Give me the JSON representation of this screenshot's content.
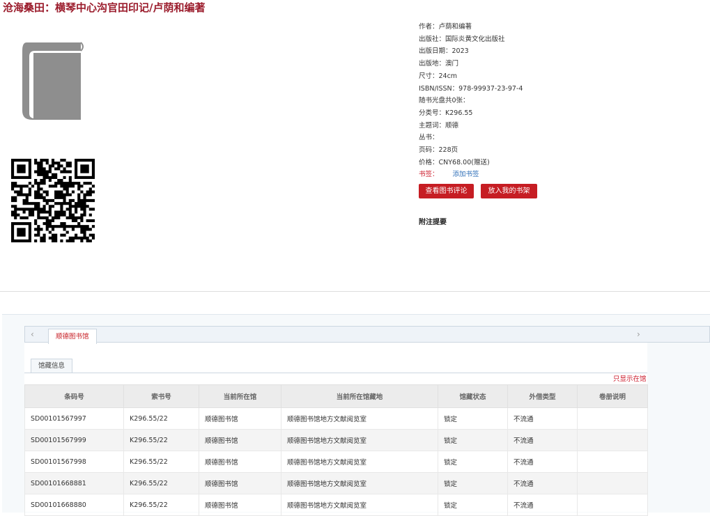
{
  "title": "沧海桑田：横琴中心沟官田印记/卢荫和编著",
  "meta": {
    "author": "作者：卢荫和编著",
    "publisher": "出版社：国际炎黄文化出版社",
    "pub_date": "出版日期：2023",
    "pub_place": "出版地：澳门",
    "size": "尺寸：24cm",
    "isbn": "ISBN/ISSN：978-99937-23-97-4",
    "cd": "随书光盘共0张：",
    "class_no": "分类号：K296.55",
    "subject": "主题词：顺德",
    "series": "丛书：",
    "pages": "页码：228页",
    "price": "价格：CNY68.00(赠送)",
    "bookmark_label": "书签：",
    "bookmark_link": "添加书签"
  },
  "buttons": {
    "reviews": "查看图书评论",
    "shelf": "放入我的书架"
  },
  "note_title": "附注提要",
  "tabs": {
    "prev": "‹",
    "next": "›",
    "library": "顺德图书馆",
    "holdings": "馆藏信息",
    "show_only": "只显示在馆"
  },
  "table": {
    "headers": [
      "条码号",
      "索书号",
      "当前所在馆",
      "当前所在馆藏地",
      "馆藏状态",
      "外借类型",
      "卷册说明"
    ],
    "rows": [
      [
        "SD00101567997",
        "K296.55/22",
        "顺德图书馆",
        "顺德图书馆地方文献阅览室",
        "锁定",
        "不流通",
        ""
      ],
      [
        "SD00101567999",
        "K296.55/22",
        "顺德图书馆",
        "顺德图书馆地方文献阅览室",
        "锁定",
        "不流通",
        ""
      ],
      [
        "SD00101567998",
        "K296.55/22",
        "顺德图书馆",
        "顺德图书馆地方文献阅览室",
        "锁定",
        "不流通",
        ""
      ],
      [
        "SD00101668881",
        "K296.55/22",
        "顺德图书馆",
        "顺德图书馆地方文献阅览室",
        "锁定",
        "不流通",
        ""
      ],
      [
        "SD00101668880",
        "K296.55/22",
        "顺德图书馆",
        "顺德图书馆地方文献阅览室",
        "锁定",
        "不流通",
        ""
      ]
    ]
  },
  "icons": {
    "book": "book-cover-placeholder-icon",
    "qr": "qr-code-icon"
  },
  "colors": {
    "title": "#9b1c2c",
    "button": "#c61d23",
    "link": "#2f6fb8"
  }
}
